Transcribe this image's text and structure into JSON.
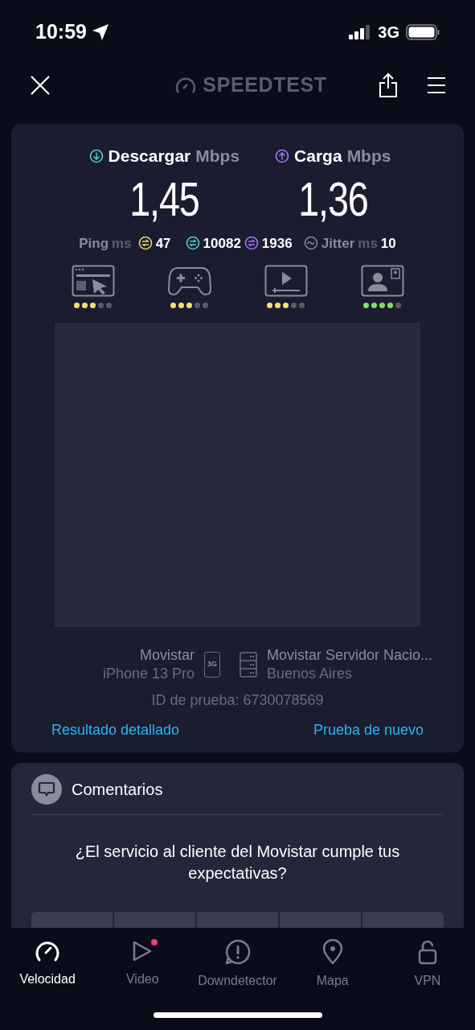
{
  "status_bar": {
    "time": "10:59",
    "network": "3G"
  },
  "header": {
    "logo": "SPEEDTEST"
  },
  "results": {
    "download": {
      "label": "Descargar",
      "unit": "Mbps",
      "value": "1,45"
    },
    "upload": {
      "label": "Carga",
      "unit": "Mbps",
      "value": "1,36"
    },
    "ping": {
      "label": "Ping",
      "unit": "ms",
      "value": "47"
    },
    "download_latency": "10082",
    "upload_latency": "1936",
    "jitter": {
      "label": "Jitter",
      "unit": "ms",
      "value": "10"
    },
    "quality": [
      {
        "kind": "web",
        "stars": 3,
        "color": "#f4e06d"
      },
      {
        "kind": "gaming",
        "stars": 3,
        "color": "#f4e06d"
      },
      {
        "kind": "video",
        "stars": 3,
        "color": "#f4e06d"
      },
      {
        "kind": "call",
        "stars": 4,
        "color": "#7ee35f"
      }
    ],
    "provider": {
      "name": "Movistar",
      "device": "iPhone 13 Pro",
      "network": "3G"
    },
    "server": {
      "name": "Movistar Servidor Nacio...",
      "location": "Buenos Aires"
    },
    "test_id": "ID de prueba: 6730078569",
    "links": [
      "Resultado detallado",
      "Prueba de nuevo"
    ]
  },
  "feedback": {
    "title": "Comentarios",
    "question": "¿El servicio al cliente del Movistar cumple tus expectativas?"
  },
  "tabs": [
    {
      "kind": "speed",
      "label": "Velocidad",
      "selected": true,
      "badge": false
    },
    {
      "kind": "video",
      "label": "Video",
      "selected": false,
      "badge": true
    },
    {
      "kind": "down",
      "label": "Downdetector",
      "selected": false,
      "badge": false
    },
    {
      "kind": "map",
      "label": "Mapa",
      "selected": false,
      "badge": false
    },
    {
      "kind": "vpn",
      "label": "VPN",
      "selected": false,
      "badge": false
    }
  ]
}
